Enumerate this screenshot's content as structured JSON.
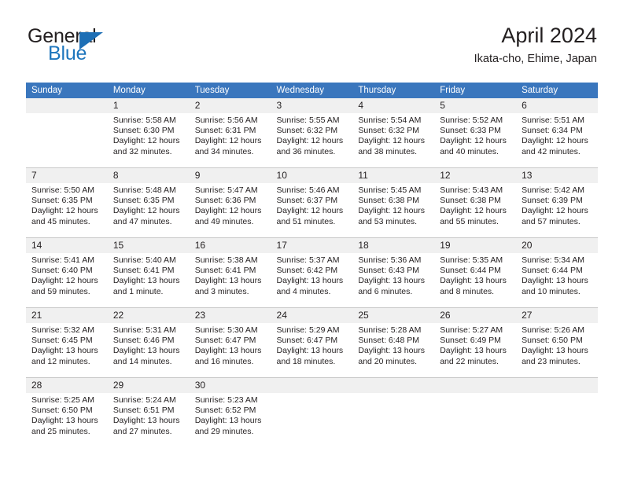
{
  "logo": {
    "word1": "General",
    "word2": "Blue",
    "triangle_color": "#1e6fb5",
    "blue_color": "#1e76bd"
  },
  "header": {
    "title": "April 2024",
    "subtitle": "Ikata-cho, Ehime, Japan"
  },
  "theme": {
    "header_bg": "#3a76bd",
    "header_text": "#ffffff",
    "daynum_bg": "#f0f0f0",
    "grid_line": "#c8c8c8",
    "body_text": "#231f20"
  },
  "weekday_headers": [
    "Sunday",
    "Monday",
    "Tuesday",
    "Wednesday",
    "Thursday",
    "Friday",
    "Saturday"
  ],
  "weeks": [
    [
      {
        "day": "",
        "lines": []
      },
      {
        "day": "1",
        "lines": [
          "Sunrise: 5:58 AM",
          "Sunset: 6:30 PM",
          "Daylight: 12 hours",
          "and 32 minutes."
        ]
      },
      {
        "day": "2",
        "lines": [
          "Sunrise: 5:56 AM",
          "Sunset: 6:31 PM",
          "Daylight: 12 hours",
          "and 34 minutes."
        ]
      },
      {
        "day": "3",
        "lines": [
          "Sunrise: 5:55 AM",
          "Sunset: 6:32 PM",
          "Daylight: 12 hours",
          "and 36 minutes."
        ]
      },
      {
        "day": "4",
        "lines": [
          "Sunrise: 5:54 AM",
          "Sunset: 6:32 PM",
          "Daylight: 12 hours",
          "and 38 minutes."
        ]
      },
      {
        "day": "5",
        "lines": [
          "Sunrise: 5:52 AM",
          "Sunset: 6:33 PM",
          "Daylight: 12 hours",
          "and 40 minutes."
        ]
      },
      {
        "day": "6",
        "lines": [
          "Sunrise: 5:51 AM",
          "Sunset: 6:34 PM",
          "Daylight: 12 hours",
          "and 42 minutes."
        ]
      }
    ],
    [
      {
        "day": "7",
        "lines": [
          "Sunrise: 5:50 AM",
          "Sunset: 6:35 PM",
          "Daylight: 12 hours",
          "and 45 minutes."
        ]
      },
      {
        "day": "8",
        "lines": [
          "Sunrise: 5:48 AM",
          "Sunset: 6:35 PM",
          "Daylight: 12 hours",
          "and 47 minutes."
        ]
      },
      {
        "day": "9",
        "lines": [
          "Sunrise: 5:47 AM",
          "Sunset: 6:36 PM",
          "Daylight: 12 hours",
          "and 49 minutes."
        ]
      },
      {
        "day": "10",
        "lines": [
          "Sunrise: 5:46 AM",
          "Sunset: 6:37 PM",
          "Daylight: 12 hours",
          "and 51 minutes."
        ]
      },
      {
        "day": "11",
        "lines": [
          "Sunrise: 5:45 AM",
          "Sunset: 6:38 PM",
          "Daylight: 12 hours",
          "and 53 minutes."
        ]
      },
      {
        "day": "12",
        "lines": [
          "Sunrise: 5:43 AM",
          "Sunset: 6:38 PM",
          "Daylight: 12 hours",
          "and 55 minutes."
        ]
      },
      {
        "day": "13",
        "lines": [
          "Sunrise: 5:42 AM",
          "Sunset: 6:39 PM",
          "Daylight: 12 hours",
          "and 57 minutes."
        ]
      }
    ],
    [
      {
        "day": "14",
        "lines": [
          "Sunrise: 5:41 AM",
          "Sunset: 6:40 PM",
          "Daylight: 12 hours",
          "and 59 minutes."
        ]
      },
      {
        "day": "15",
        "lines": [
          "Sunrise: 5:40 AM",
          "Sunset: 6:41 PM",
          "Daylight: 13 hours",
          "and 1 minute."
        ]
      },
      {
        "day": "16",
        "lines": [
          "Sunrise: 5:38 AM",
          "Sunset: 6:41 PM",
          "Daylight: 13 hours",
          "and 3 minutes."
        ]
      },
      {
        "day": "17",
        "lines": [
          "Sunrise: 5:37 AM",
          "Sunset: 6:42 PM",
          "Daylight: 13 hours",
          "and 4 minutes."
        ]
      },
      {
        "day": "18",
        "lines": [
          "Sunrise: 5:36 AM",
          "Sunset: 6:43 PM",
          "Daylight: 13 hours",
          "and 6 minutes."
        ]
      },
      {
        "day": "19",
        "lines": [
          "Sunrise: 5:35 AM",
          "Sunset: 6:44 PM",
          "Daylight: 13 hours",
          "and 8 minutes."
        ]
      },
      {
        "day": "20",
        "lines": [
          "Sunrise: 5:34 AM",
          "Sunset: 6:44 PM",
          "Daylight: 13 hours",
          "and 10 minutes."
        ]
      }
    ],
    [
      {
        "day": "21",
        "lines": [
          "Sunrise: 5:32 AM",
          "Sunset: 6:45 PM",
          "Daylight: 13 hours",
          "and 12 minutes."
        ]
      },
      {
        "day": "22",
        "lines": [
          "Sunrise: 5:31 AM",
          "Sunset: 6:46 PM",
          "Daylight: 13 hours",
          "and 14 minutes."
        ]
      },
      {
        "day": "23",
        "lines": [
          "Sunrise: 5:30 AM",
          "Sunset: 6:47 PM",
          "Daylight: 13 hours",
          "and 16 minutes."
        ]
      },
      {
        "day": "24",
        "lines": [
          "Sunrise: 5:29 AM",
          "Sunset: 6:47 PM",
          "Daylight: 13 hours",
          "and 18 minutes."
        ]
      },
      {
        "day": "25",
        "lines": [
          "Sunrise: 5:28 AM",
          "Sunset: 6:48 PM",
          "Daylight: 13 hours",
          "and 20 minutes."
        ]
      },
      {
        "day": "26",
        "lines": [
          "Sunrise: 5:27 AM",
          "Sunset: 6:49 PM",
          "Daylight: 13 hours",
          "and 22 minutes."
        ]
      },
      {
        "day": "27",
        "lines": [
          "Sunrise: 5:26 AM",
          "Sunset: 6:50 PM",
          "Daylight: 13 hours",
          "and 23 minutes."
        ]
      }
    ],
    [
      {
        "day": "28",
        "lines": [
          "Sunrise: 5:25 AM",
          "Sunset: 6:50 PM",
          "Daylight: 13 hours",
          "and 25 minutes."
        ]
      },
      {
        "day": "29",
        "lines": [
          "Sunrise: 5:24 AM",
          "Sunset: 6:51 PM",
          "Daylight: 13 hours",
          "and 27 minutes."
        ]
      },
      {
        "day": "30",
        "lines": [
          "Sunrise: 5:23 AM",
          "Sunset: 6:52 PM",
          "Daylight: 13 hours",
          "and 29 minutes."
        ]
      },
      {
        "day": "",
        "lines": []
      },
      {
        "day": "",
        "lines": []
      },
      {
        "day": "",
        "lines": []
      },
      {
        "day": "",
        "lines": []
      }
    ]
  ]
}
